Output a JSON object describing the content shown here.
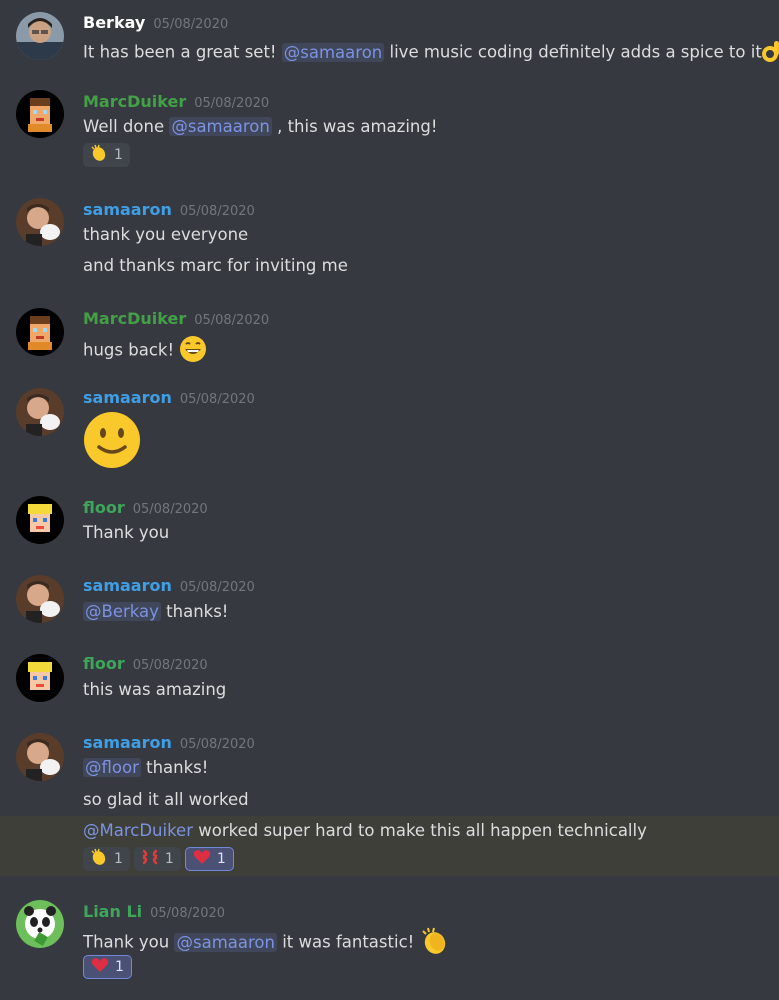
{
  "colors": {
    "background": "#36393f",
    "username_berkay": "#ffffff",
    "username_marc": "#43a047",
    "username_samaaron": "#3f9fe6",
    "username_floor": "#3ea65a",
    "username_lianli": "#3ea65a",
    "mention": "#7b93e0",
    "timestamp": "#72767d"
  },
  "messages": [
    {
      "user": "Berkay",
      "time": "05/08/2020",
      "avatar": "photo-avatar",
      "text_pre": "It has been a great set!",
      "mention": "@samaaron",
      "text_post": "live music coding definitely adds a spice to it",
      "emoji": "ok-hand-icon"
    },
    {
      "user": "MarcDuiker",
      "time": "05/08/2020",
      "avatar": "pixel-avatar",
      "text_pre": "Well done",
      "mention": "@samaaron",
      "text_post": ", this was amazing!",
      "reaction_count": "1"
    },
    {
      "user": "samaaron",
      "time": "05/08/2020",
      "avatar": "photo-avatar",
      "line1": "thank you everyone",
      "line2": "and thanks marc for inviting me"
    },
    {
      "user": "MarcDuiker",
      "time": "05/08/2020",
      "text": "hugs back!"
    },
    {
      "user": "samaaron",
      "time": "05/08/2020",
      "emoji": "slightly-smiling-face-icon"
    },
    {
      "user": "floor",
      "time": "05/08/2020",
      "text": "Thank you"
    },
    {
      "user": "samaaron",
      "time": "05/08/2020",
      "mention": "@Berkay",
      "text_post": "thanks!"
    },
    {
      "user": "floor",
      "time": "05/08/2020",
      "text": "this was amazing"
    },
    {
      "user": "samaaron",
      "time": "05/08/2020",
      "mention": "@floor",
      "text_post": "thanks!",
      "line2": "so glad it all worked",
      "line3_mention": "@MarcDuiker",
      "line3_text": "worked super hard to make this all happen technically",
      "reactions": [
        "1",
        "1",
        "1"
      ]
    },
    {
      "user": "Lian Li",
      "time": "05/08/2020",
      "text_pre": "Thank you",
      "mention": "@samaaron",
      "text_post": "it was fantastic!",
      "reaction_count": "1"
    }
  ]
}
